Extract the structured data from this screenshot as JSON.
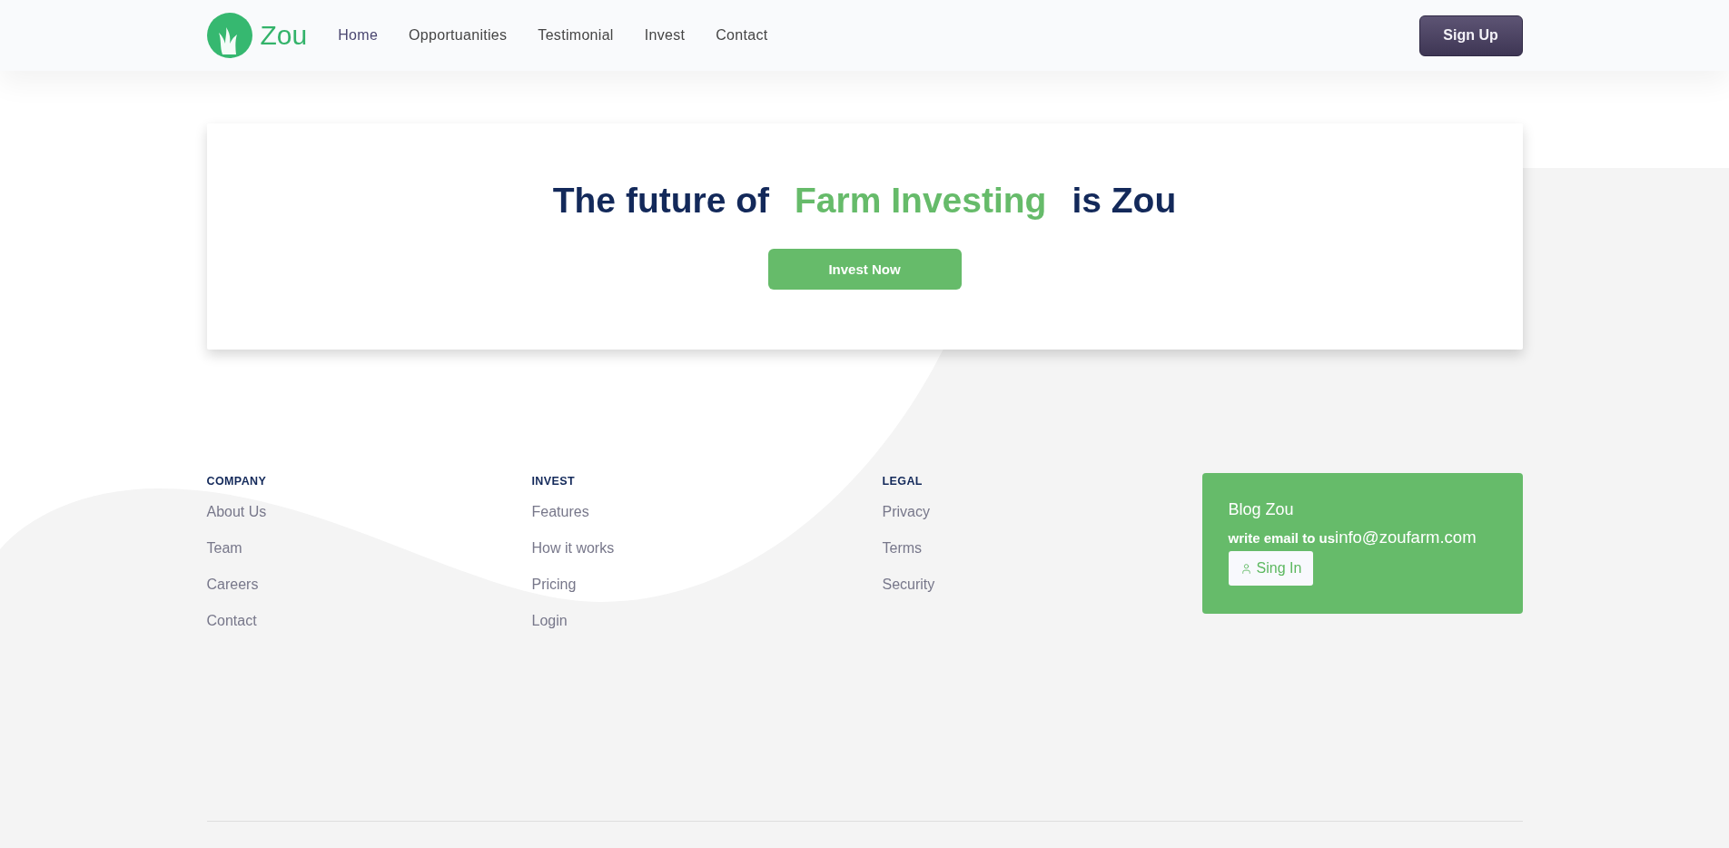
{
  "header": {
    "logo": {
      "text": "Zou"
    },
    "nav": [
      {
        "label": "Home",
        "selected": true
      },
      {
        "label": "Opportuanities",
        "selected": false
      },
      {
        "label": "Testimonial",
        "selected": false
      },
      {
        "label": "Invest",
        "selected": false
      },
      {
        "label": "Contact",
        "selected": false
      }
    ],
    "sign_up_button": "Sign Up"
  },
  "hero": {
    "title_parts": [
      {
        "text": "The future of",
        "highlight": false
      },
      {
        "text": "Farm Investing",
        "highlight": true
      },
      {
        "text": "is Zou",
        "highlight": false
      }
    ],
    "cta_button": "Invest Now"
  },
  "footer": {
    "columns": [
      {
        "heading": "COMPANY",
        "links": [
          "About Us",
          "Team",
          "Careers",
          "Contact"
        ]
      },
      {
        "heading": "INVEST",
        "links": [
          "Features",
          "How it works",
          "Pricing",
          "Login"
        ]
      },
      {
        "heading": "LEGAL",
        "links": [
          "Privacy",
          "Terms",
          "Security"
        ]
      }
    ],
    "blog": {
      "title": "Blog Zou",
      "prefix": "write email to us",
      "email": "info@zoufarm.com",
      "button": "Sing In"
    }
  }
}
